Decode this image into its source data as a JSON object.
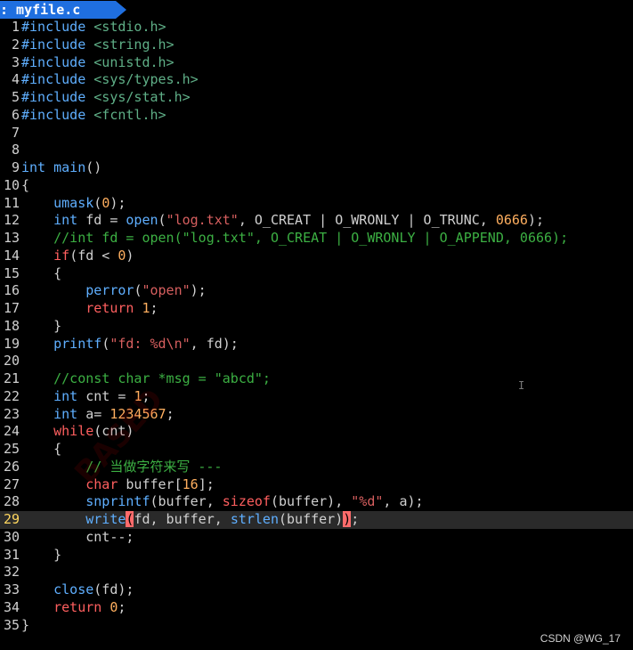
{
  "tabline": {
    "tab_label": ": myfile.c"
  },
  "editor": {
    "current_line": 29,
    "lines": [
      {
        "n": "1",
        "tokens": [
          [
            "pre",
            "#include "
          ],
          [
            "inc",
            "<stdio.h>"
          ]
        ]
      },
      {
        "n": "2",
        "tokens": [
          [
            "pre",
            "#include "
          ],
          [
            "inc",
            "<string.h>"
          ]
        ]
      },
      {
        "n": "3",
        "tokens": [
          [
            "pre",
            "#include "
          ],
          [
            "inc",
            "<unistd.h>"
          ]
        ]
      },
      {
        "n": "4",
        "tokens": [
          [
            "pre",
            "#include "
          ],
          [
            "inc",
            "<sys/types.h>"
          ]
        ]
      },
      {
        "n": "5",
        "tokens": [
          [
            "pre",
            "#include "
          ],
          [
            "inc",
            "<sys/stat.h>"
          ]
        ]
      },
      {
        "n": "6",
        "tokens": [
          [
            "pre",
            "#include "
          ],
          [
            "inc",
            "<fcntl.h>"
          ]
        ]
      },
      {
        "n": "7",
        "tokens": []
      },
      {
        "n": "8",
        "tokens": []
      },
      {
        "n": "9",
        "tokens": [
          [
            "type",
            "int"
          ],
          [
            "plain",
            " "
          ],
          [
            "fn",
            "main"
          ],
          [
            "plain",
            "()"
          ]
        ]
      },
      {
        "n": "10",
        "tokens": [
          [
            "plain",
            "{"
          ]
        ]
      },
      {
        "n": "11",
        "tokens": [
          [
            "plain",
            "    "
          ],
          [
            "fn",
            "umask"
          ],
          [
            "plain",
            "("
          ],
          [
            "num",
            "0"
          ],
          [
            "plain",
            ");"
          ]
        ]
      },
      {
        "n": "12",
        "tokens": [
          [
            "plain",
            "    "
          ],
          [
            "type",
            "int"
          ],
          [
            "plain",
            " fd = "
          ],
          [
            "fn",
            "open"
          ],
          [
            "plain",
            "("
          ],
          [
            "str",
            "\"log.txt\""
          ],
          [
            "plain",
            ", O_CREAT | O_WRONLY | O_TRUNC, "
          ],
          [
            "num",
            "0666"
          ],
          [
            "plain",
            ");"
          ]
        ]
      },
      {
        "n": "13",
        "tokens": [
          [
            "plain",
            "    "
          ],
          [
            "cmt",
            "//int fd = open(\"log.txt\", O_CREAT | O_WRONLY | O_APPEND, 0666);"
          ]
        ]
      },
      {
        "n": "14",
        "tokens": [
          [
            "plain",
            "    "
          ],
          [
            "kw",
            "if"
          ],
          [
            "plain",
            "(fd < "
          ],
          [
            "num",
            "0"
          ],
          [
            "plain",
            ")"
          ]
        ]
      },
      {
        "n": "15",
        "tokens": [
          [
            "plain",
            "    {"
          ]
        ]
      },
      {
        "n": "16",
        "tokens": [
          [
            "plain",
            "        "
          ],
          [
            "fn",
            "perror"
          ],
          [
            "plain",
            "("
          ],
          [
            "str",
            "\"open\""
          ],
          [
            "plain",
            ");"
          ]
        ]
      },
      {
        "n": "17",
        "tokens": [
          [
            "plain",
            "        "
          ],
          [
            "kw",
            "return"
          ],
          [
            "plain",
            " "
          ],
          [
            "num",
            "1"
          ],
          [
            "plain",
            ";"
          ]
        ]
      },
      {
        "n": "18",
        "tokens": [
          [
            "plain",
            "    }"
          ]
        ]
      },
      {
        "n": "19",
        "tokens": [
          [
            "plain",
            "    "
          ],
          [
            "fn",
            "printf"
          ],
          [
            "plain",
            "("
          ],
          [
            "str",
            "\"fd: %d\\n\""
          ],
          [
            "plain",
            ", fd);"
          ]
        ]
      },
      {
        "n": "20",
        "tokens": []
      },
      {
        "n": "21",
        "tokens": [
          [
            "plain",
            "    "
          ],
          [
            "cmt",
            "//const char *msg = \"abcd\";"
          ]
        ]
      },
      {
        "n": "22",
        "tokens": [
          [
            "plain",
            "    "
          ],
          [
            "type",
            "int"
          ],
          [
            "plain",
            " cnt = "
          ],
          [
            "num",
            "1"
          ],
          [
            "plain",
            ";"
          ]
        ]
      },
      {
        "n": "23",
        "tokens": [
          [
            "plain",
            "    "
          ],
          [
            "type",
            "int"
          ],
          [
            "plain",
            " a= "
          ],
          [
            "num",
            "1234567"
          ],
          [
            "plain",
            ";"
          ]
        ]
      },
      {
        "n": "24",
        "tokens": [
          [
            "plain",
            "    "
          ],
          [
            "kw",
            "while"
          ],
          [
            "plain",
            "(cnt)"
          ]
        ]
      },
      {
        "n": "25",
        "tokens": [
          [
            "plain",
            "    {"
          ]
        ]
      },
      {
        "n": "26",
        "tokens": [
          [
            "plain",
            "        "
          ],
          [
            "cmt",
            "// 当做字符来写 ---"
          ]
        ]
      },
      {
        "n": "27",
        "tokens": [
          [
            "plain",
            "        "
          ],
          [
            "kw",
            "char"
          ],
          [
            "plain",
            " buffer["
          ],
          [
            "num",
            "16"
          ],
          [
            "plain",
            "];"
          ]
        ]
      },
      {
        "n": "28",
        "tokens": [
          [
            "plain",
            "        "
          ],
          [
            "fn",
            "snprintf"
          ],
          [
            "plain",
            "(buffer, "
          ],
          [
            "kw",
            "sizeof"
          ],
          [
            "plain",
            "(buffer), "
          ],
          [
            "str",
            "\"%d\""
          ],
          [
            "plain",
            ", a);"
          ]
        ]
      },
      {
        "n": "29",
        "tokens": [
          [
            "plain",
            "        "
          ],
          [
            "fn",
            "write"
          ],
          [
            "hl",
            "("
          ],
          [
            "plain",
            "fd, buffer, "
          ],
          [
            "fn",
            "strlen"
          ],
          [
            "plain",
            "(buffer)"
          ],
          [
            "hl",
            ")"
          ],
          [
            "plain",
            ";"
          ]
        ]
      },
      {
        "n": "30",
        "tokens": [
          [
            "plain",
            "        cnt--;"
          ]
        ]
      },
      {
        "n": "31",
        "tokens": [
          [
            "plain",
            "    }"
          ]
        ]
      },
      {
        "n": "32",
        "tokens": []
      },
      {
        "n": "33",
        "tokens": [
          [
            "plain",
            "    "
          ],
          [
            "fn",
            "close"
          ],
          [
            "plain",
            "(fd);"
          ]
        ]
      },
      {
        "n": "34",
        "tokens": [
          [
            "plain",
            "    "
          ],
          [
            "kw",
            "return"
          ],
          [
            "plain",
            " "
          ],
          [
            "num",
            "0"
          ],
          [
            "plain",
            ";"
          ]
        ]
      },
      {
        "n": "35",
        "tokens": [
          [
            "plain",
            "}"
          ]
        ]
      }
    ]
  },
  "watermark_text": "BASED",
  "credit": "CSDN @WG_17",
  "colors": {
    "background": "#000000",
    "tab": "#1f6fe0",
    "keyword_type": "#5fafff",
    "keyword_flow": "#ff5f5f",
    "number": "#ffaf5f",
    "string": "#d75f5f",
    "comment": "#3cb043",
    "bracket_match": "#ff6b6b"
  }
}
